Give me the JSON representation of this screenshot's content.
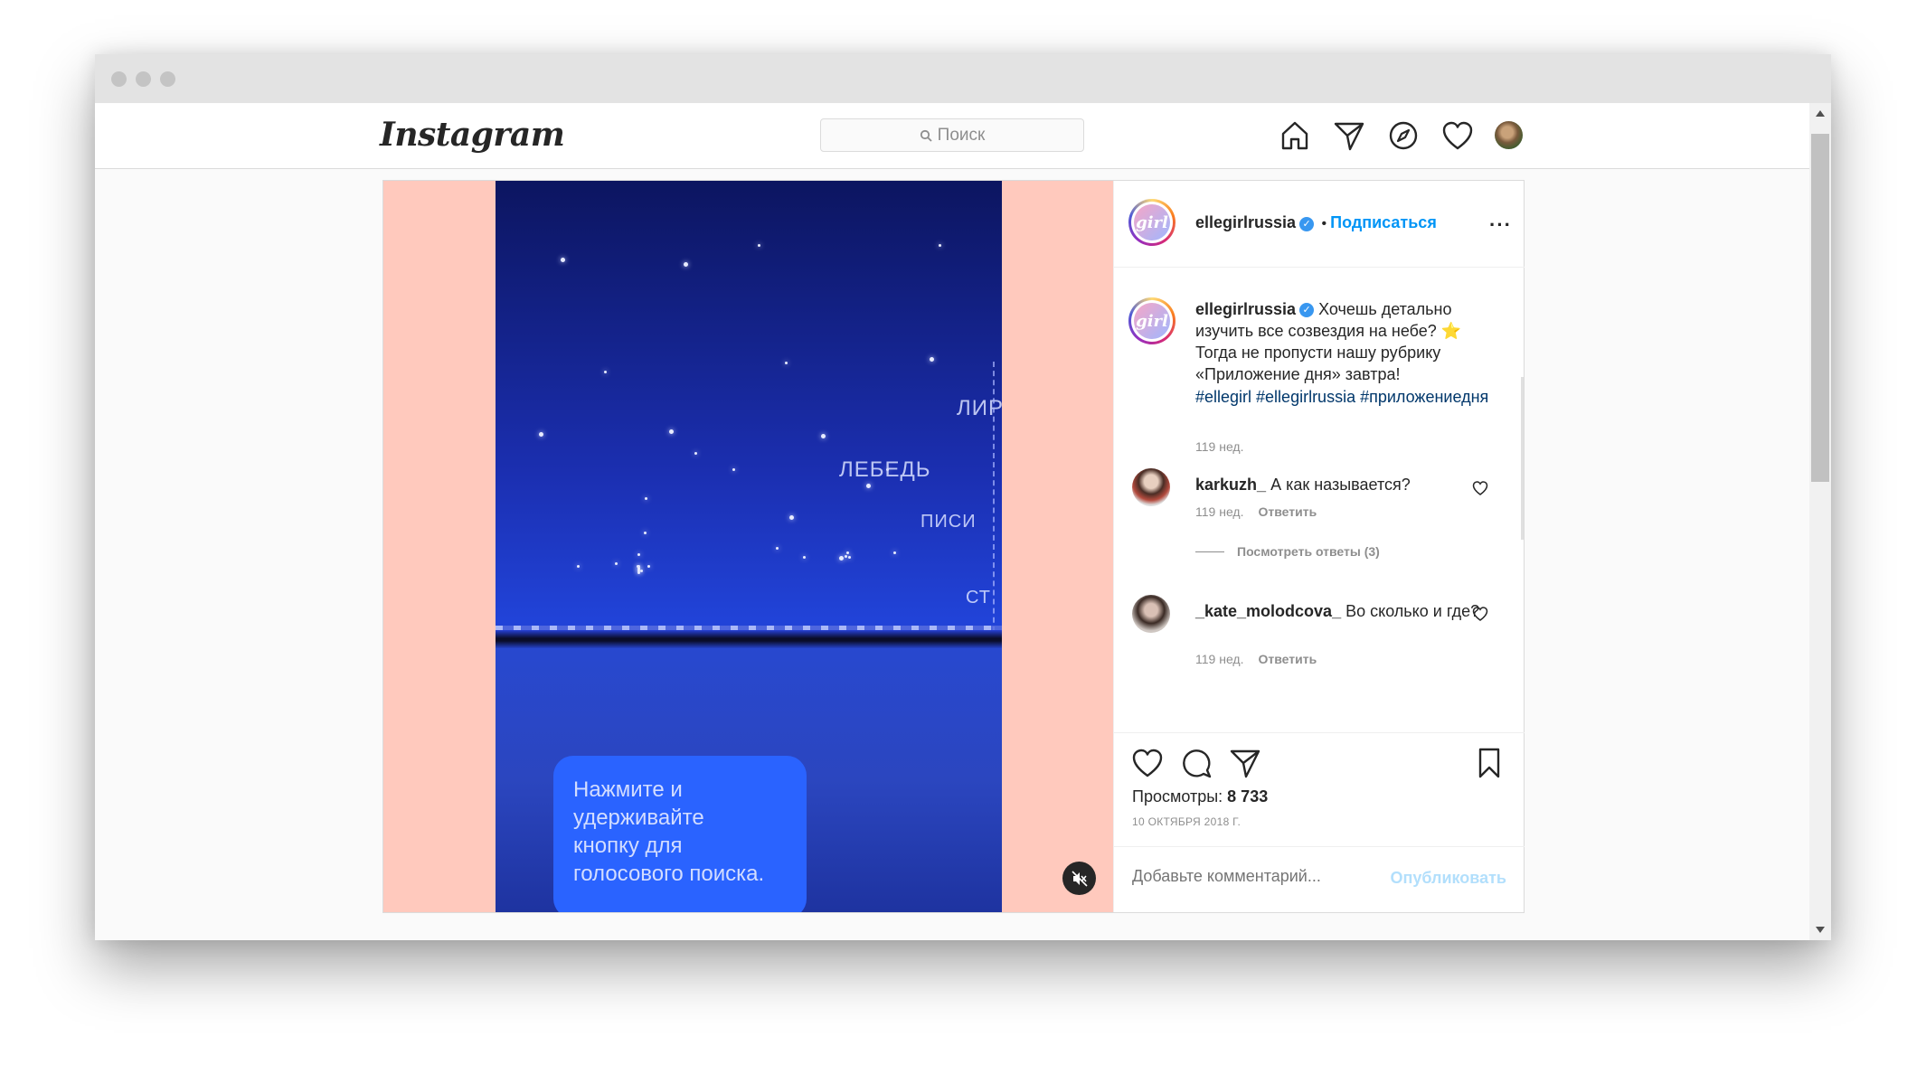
{
  "header": {
    "logo": "Instagram",
    "search_placeholder": "Поиск"
  },
  "nav": [
    "home-icon",
    "direct-icon",
    "explore-icon",
    "activity-heart-icon",
    "profile-avatar"
  ],
  "media": {
    "constellations": [
      "ЛЕБЕДЬ",
      "ЛИР",
      "ПИСИ",
      "СТ"
    ],
    "tooltip": "Нажмите и\nудерживайте\nкнопку для\nголосового поиска."
  },
  "post": {
    "username": "ellegirlrussia",
    "follow": "Подписаться",
    "avatar_text": "girl",
    "caption": "Хочешь детально изучить все созвездия на небе? ⭐ Тогда не пропусти нашу рубрику «Приложение дня» завтра!",
    "hashtags": "#ellegirl #ellegirlrussia #приложениедня",
    "caption_time": "119 нед.",
    "comments": [
      {
        "user": "karkuzh_",
        "text": "А как называется?",
        "time": "119 нед.",
        "reply": "Ответить",
        "view_replies": "Посмотреть ответы (3)"
      },
      {
        "user": "_kate_molodcova_",
        "text": "Во сколько и где?",
        "time": "119 нед.",
        "reply": "Ответить"
      }
    ],
    "views_label": "Просмотры:",
    "views_count": "8 733",
    "date": "10 ОКТЯБРЯ 2018 Г.",
    "add_comment_placeholder": "Добавьте комментарий...",
    "publish": "Опубликовать"
  },
  "colors": {
    "accent": "#0095f6",
    "media_bg": "#ffc9bd",
    "tooltip": "#2a63ff"
  }
}
